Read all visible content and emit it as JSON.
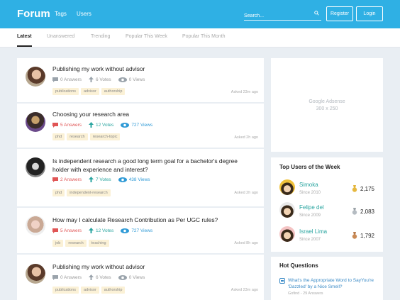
{
  "header": {
    "brand": "Forum",
    "nav": [
      "Tags",
      "Users"
    ],
    "search_placeholder": "Search...",
    "register_label": "Register",
    "login_label": "Login"
  },
  "tabs": [
    "Latest",
    "Unanswered",
    "Trending",
    "Popular This Week",
    "Popular This Month"
  ],
  "active_tab": "Latest",
  "questions": [
    {
      "title": "Publishing my work without advisor",
      "answers": "0 Answers",
      "votes": "6 Votes",
      "views": "0 Views",
      "tags": [
        "publications",
        "advisor",
        "authorship"
      ],
      "asked": "Asked 23m ago"
    },
    {
      "title": "Choosing your research area",
      "answers": "5 Answers",
      "votes": "12 Votes",
      "views": "727 Views",
      "tags": [
        "phd",
        "research",
        "research-topic"
      ],
      "asked": "Asked 2h ago"
    },
    {
      "title": "Is independent research a good long term goal for a bachelor's degree holder with experience and interest?",
      "answers": "2 Answers",
      "votes": "7 Votes",
      "views": "438 Views",
      "tags": [
        "phd",
        "independent-research"
      ],
      "asked": "Asked 2h ago"
    },
    {
      "title": "How may I calculate Research Contribution as Per UGC rules?",
      "answers": "5 Answers",
      "votes": "12 Votes",
      "views": "727 Views",
      "tags": [
        "job",
        "research",
        "teaching"
      ],
      "asked": "Asked 8h ago"
    },
    {
      "title": "Publishing my work without advisor",
      "answers": "0 Answers",
      "votes": "6 Votes",
      "views": "0 Views",
      "tags": [
        "publications",
        "advisor",
        "authorship"
      ],
      "asked": "Asked 23m ago"
    }
  ],
  "ad": {
    "line1": "Google Adsense",
    "line2": "300 x 250"
  },
  "top_users": {
    "title": "Top Users of the Week",
    "users": [
      {
        "name": "Simoka",
        "since": "Since 2010",
        "score": "2,175",
        "medal": "gold"
      },
      {
        "name": "Felipe del",
        "since": "Since 2009",
        "score": "2,083",
        "medal": "silver"
      },
      {
        "name": "Israel Lima",
        "since": "Since 2007",
        "score": "1,792",
        "medal": "bronze"
      }
    ]
  },
  "hot_questions": {
    "title": "Hot Questions",
    "items": [
      {
        "text": "What's the Appropriate Word to SayYou're 'Dazzled' by a Nice Smell?",
        "meta": "Gofind - 29 Answers"
      }
    ]
  },
  "colors": {
    "accent": "#2fb0e4",
    "answers_red": "#e05555",
    "votes_green": "#2aa5a0",
    "views_blue": "#2f9ad6",
    "tag_bg": "#fbf1d6"
  }
}
